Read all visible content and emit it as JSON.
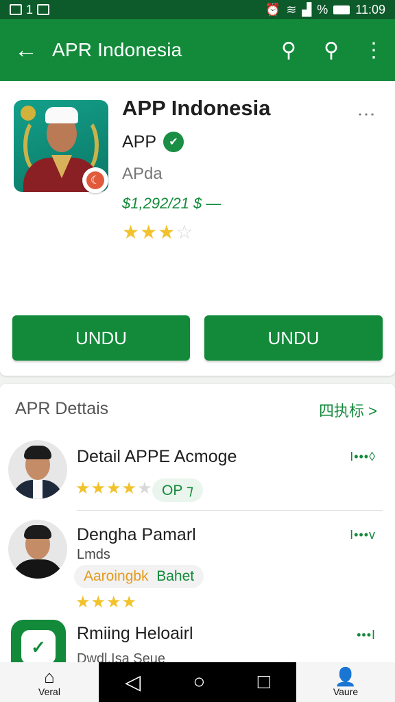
{
  "status_bar": {
    "time": "11:09",
    "battery_text": "%",
    "left_glyph": "1"
  },
  "app_bar": {
    "title": "APR Indonesia",
    "back_icon": "←",
    "search_icon": "⚲",
    "search_icon_2": "⚲",
    "more_icon": "⋮"
  },
  "app": {
    "name": "APP Indonesia",
    "developer": "APP",
    "category": "APda",
    "price": "$1,292/21 $ —",
    "rating": 3,
    "rating_max": 5,
    "badge_icon": "☾",
    "verified_icon": "✔",
    "more_icon": "⋮"
  },
  "buttons": {
    "install_1": "UNDU",
    "install_2": "UNDU"
  },
  "details": {
    "title": "APR Dettais",
    "link": "四执标 >",
    "items": [
      {
        "title": "Detail APPE Acmoge",
        "meta": "I•••◊",
        "rating": 4,
        "pill": "OP ⁊"
      },
      {
        "title": "Dengha Pamarl",
        "subtitle": "Lmds",
        "meta": "I•••v",
        "pill_orange": "Aaroingbk",
        "pill_green": "Bahet",
        "rating": 4
      },
      {
        "title": "Rmiing Heloairl",
        "meta": "•••I",
        "partial": "Dwdl.Isa Seue",
        "icon": "✓"
      }
    ]
  },
  "nav": {
    "home_label": "Veral",
    "home_icon": "⌂",
    "back_icon": "◁",
    "home_circle_icon": "○",
    "recents_icon": "□",
    "profile_label": "Vaure",
    "profile_icon": "👤"
  },
  "colors": {
    "primary": "#128a3a",
    "status": "#0d5a2a",
    "star": "#f2c22b"
  }
}
